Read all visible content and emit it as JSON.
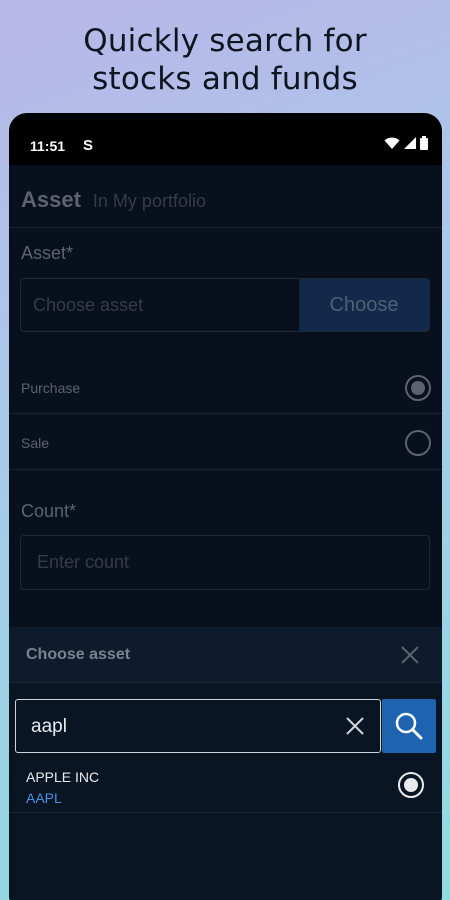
{
  "headline": {
    "line1": "Quickly search for",
    "line2": "stocks and funds"
  },
  "status_bar": {
    "time": "11:51",
    "app_indicator": "S",
    "icons": [
      "wifi-icon",
      "signal-icon",
      "battery-icon"
    ]
  },
  "form": {
    "header_title": "Asset",
    "header_subtitle": "In My portfolio",
    "asset_label": "Asset*",
    "asset_placeholder": "Choose asset",
    "choose_button": "Choose",
    "options": [
      {
        "label": "Purchase",
        "selected": true
      },
      {
        "label": "Sale",
        "selected": false
      }
    ],
    "count_label": "Count*",
    "count_placeholder": "Enter count"
  },
  "sheet": {
    "title": "Choose asset",
    "search_value": "aapl",
    "results": [
      {
        "name": "APPLE INC",
        "ticker": "AAPL",
        "selected": true
      }
    ]
  },
  "colors": {
    "accent": "#1d63b0",
    "ticker": "#4a90e2",
    "background": "#07101c"
  }
}
